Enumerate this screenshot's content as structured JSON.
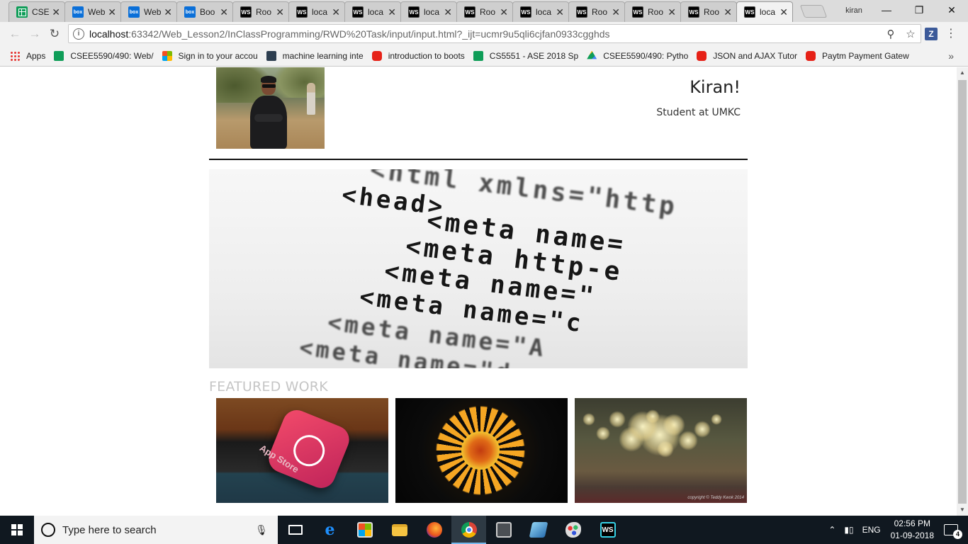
{
  "browser": {
    "tabs": [
      {
        "title": "CSE",
        "icon": "sheets-icon"
      },
      {
        "title": "Web",
        "icon": "box-icon"
      },
      {
        "title": "Web",
        "icon": "box-icon"
      },
      {
        "title": "Boo",
        "icon": "box-icon"
      },
      {
        "title": "Roo",
        "icon": "webstorm-icon"
      },
      {
        "title": "loca",
        "icon": "webstorm-icon"
      },
      {
        "title": "loca",
        "icon": "webstorm-icon"
      },
      {
        "title": "loca",
        "icon": "webstorm-icon"
      },
      {
        "title": "Roo",
        "icon": "webstorm-icon"
      },
      {
        "title": "loca",
        "icon": "webstorm-icon"
      },
      {
        "title": "Roo",
        "icon": "webstorm-icon"
      },
      {
        "title": "Roo",
        "icon": "webstorm-icon"
      },
      {
        "title": "Roo",
        "icon": "webstorm-icon"
      },
      {
        "title": "loca",
        "icon": "webstorm-icon"
      }
    ],
    "active_tab_index": 13,
    "profile_name": "kiran",
    "url_host": "localhost",
    "url_path": ":63342/Web_Lesson2/InClassProgramming/RWD%20Task/input/input.html?_ijt=ucmr9u5qli6cjfan0933cgghds",
    "extension_label": "Z",
    "bookmarks": [
      {
        "label": "Apps",
        "icon": "apps-icon"
      },
      {
        "label": "CSEE5590/490: Web/",
        "icon": "sheets-icon"
      },
      {
        "label": "Sign in to your accou",
        "icon": "microsoft-icon"
      },
      {
        "label": "machine learning inte",
        "icon": "bookmark-icon"
      },
      {
        "label": "introduction to boots",
        "icon": "youtube-icon"
      },
      {
        "label": "CS5551 - ASE 2018 Sp",
        "icon": "sheets-icon"
      },
      {
        "label": "CSEE5590/490: Pytho",
        "icon": "drive-icon"
      },
      {
        "label": "JSON and AJAX Tutor",
        "icon": "youtube-icon"
      },
      {
        "label": "Paytm Payment Gatew",
        "icon": "youtube-icon"
      }
    ]
  },
  "page": {
    "name": "Kiran!",
    "subtitle": "Student at UMKC",
    "banner_code_lines": [
      "<html  xmlns=\"http",
      "<head>",
      "<meta  name=",
      "<meta  http-e",
      "<meta  name=\"",
      "<meta  name=\"c",
      "<meta  name=\"A",
      "<meta  name=\"d"
    ],
    "featured_heading": "FEATURED WORK",
    "featured_items": [
      {
        "caption": "App Store"
      },
      {
        "caption": ""
      },
      {
        "caption": "copyright © Teddy Kwok 2014"
      }
    ]
  },
  "taskbar": {
    "search_placeholder": "Type here to search",
    "language": "ENG",
    "time": "02:56 PM",
    "date": "01-09-2018",
    "notification_count": "4"
  }
}
